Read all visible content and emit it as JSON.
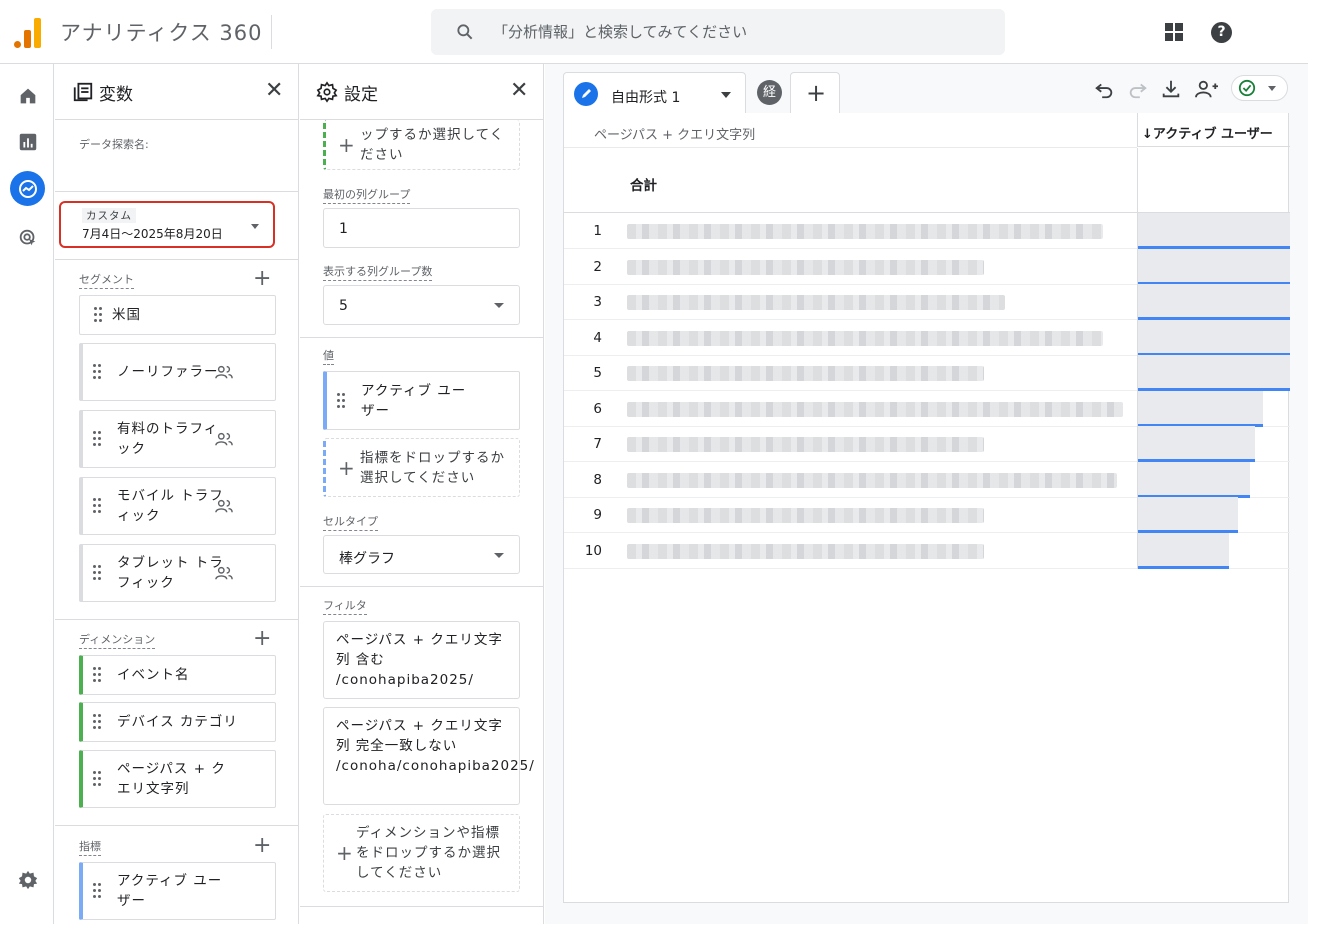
{
  "app": {
    "title": "アナリティクス 360"
  },
  "search": {
    "placeholder": "「分析情報」と検索してみてください"
  },
  "variables_panel": {
    "title": "変数",
    "exploration_name_label": "データ探索名:",
    "date_range": {
      "label": "カスタム",
      "value": "7月4日～2025年8月20日"
    },
    "segments": {
      "label": "セグメント",
      "items": [
        "米国",
        "ノーリファラー",
        "有料のトラフィック",
        "モバイル トラフィック",
        "タブレット トラフィック"
      ]
    },
    "dimensions": {
      "label": "ディメンション",
      "items": [
        "イベント名",
        "デバイス カテゴリ",
        "ページパス + クエリ文字列"
      ]
    },
    "metrics": {
      "label": "指標",
      "items": [
        "アクティブ ユーザー"
      ]
    }
  },
  "settings_panel": {
    "title": "設定",
    "top_drop_text": "ップするか選択してください",
    "first_column_group": {
      "label": "最初の列グループ",
      "value": "1"
    },
    "column_groups_shown": {
      "label": "表示する列グループ数",
      "value": "5"
    },
    "values": {
      "label": "値",
      "item": "アクティブ ユーザー",
      "drop_text": "指標をドロップするか選択してください"
    },
    "cell_type": {
      "label": "セルタイプ",
      "value": "棒グラフ"
    },
    "filters": {
      "label": "フィルタ",
      "items": [
        "ページパス + クエリ文字列 含む /conohapiba2025/",
        "ページパス + クエリ文字列 完全一致しない /conoha/conohapiba2025/"
      ],
      "drop_text": "ディメンションや指標をドロップするか選択してください"
    }
  },
  "report": {
    "tab_label": "自由形式 1",
    "badge": "経",
    "dimension_header": "ページパス + クエリ文字列",
    "metric_header": "↓アクティブ ユーザー",
    "total_label": "合計",
    "rows": [
      {
        "index": "1",
        "share": 1.0
      },
      {
        "index": "2",
        "share": 1.0
      },
      {
        "index": "3",
        "share": 1.0
      },
      {
        "index": "4",
        "share": 1.0
      },
      {
        "index": "5",
        "share": 1.0
      },
      {
        "index": "6",
        "share": 0.82
      },
      {
        "index": "7",
        "share": 0.77
      },
      {
        "index": "8",
        "share": 0.74
      },
      {
        "index": "9",
        "share": 0.66
      },
      {
        "index": "10",
        "share": 0.6
      }
    ]
  },
  "colors": {
    "accent": "#1a73e8",
    "bar": "#4285f4",
    "highlight": "#d93025",
    "dimension_edge": "#4caf50"
  }
}
